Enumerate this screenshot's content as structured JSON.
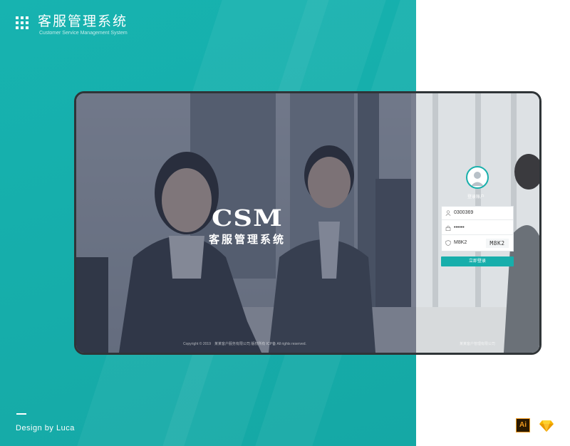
{
  "brand": {
    "title": "客服管理系统",
    "subtitle": "Customer Service Management System"
  },
  "design_credit": "Design by Luca",
  "tool_icons": [
    {
      "name": "adobe-illustrator-icon",
      "label": "Ai"
    },
    {
      "name": "sketch-icon"
    }
  ],
  "hero": {
    "logo_text": "CSM",
    "subtitle": "客服管理系统",
    "copyright": "Copyright © 2019　某某客户服务有限公司 版权所有 ICP备 All rights reserved."
  },
  "login": {
    "avatar_label": "登录账户",
    "username_value": "0300369",
    "password_value": "••••••",
    "captcha_input_value": "M8K2",
    "captcha_image_text": "M8K2",
    "submit_label": "立即登录",
    "footer_text": "某某客户管理有限公司"
  },
  "colors": {
    "brand_teal": "#17b3b0",
    "button_teal": "#17aeab",
    "mockup_border": "#2f3437"
  }
}
